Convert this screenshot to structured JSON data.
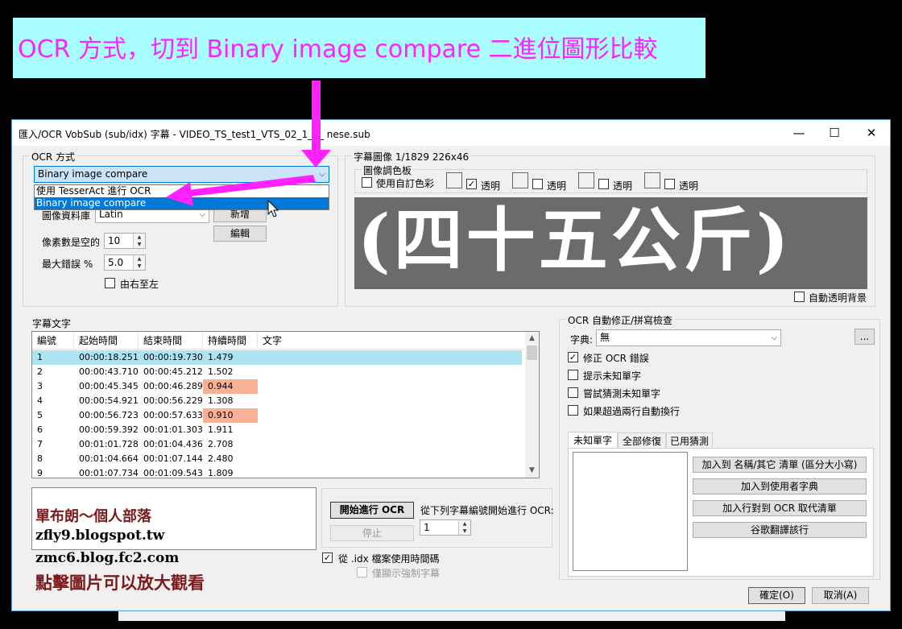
{
  "banner": {
    "text": "OCR 方式，切到 Binary image compare 二進位圖形比較"
  },
  "window": {
    "title": "匯入/OCR VobSub (sub/idx) 字幕 - VIDEO_TS_test1_VTS_02_1_0_  nese.sub",
    "minimize": "—",
    "maximize": "☐",
    "close": "✕"
  },
  "ocr_method": {
    "group_title": "OCR 方式",
    "selected": "Binary image compare",
    "options": [
      "使用 TesserAct 進行 OCR",
      "Binary image compare"
    ],
    "image_db_label": "圖像資料庫",
    "image_db_value": "Latin",
    "new_button": "新增",
    "edit_button": "編輯",
    "pixels_space_label": "像素數是空的",
    "pixels_space_value": "10",
    "max_error_label": "最大錯誤 %",
    "max_error_value": "5.0",
    "rtl_label": "由右至左"
  },
  "subtitle_image": {
    "group_title": "字幕圖像 1/1829   226x46",
    "palette_title": "圖像調色板",
    "custom_colors_label": "使用自訂色彩",
    "transparent_label": "透明",
    "preview_text": "(四十五公斤)",
    "auto_transparent_label": "自動透明背景"
  },
  "subtitle_text": {
    "group_title": "字幕文字",
    "columns": [
      "編號",
      "起始時間",
      "結束時間",
      "持續時間",
      "文字"
    ],
    "rows": [
      {
        "num": "1",
        "start": "00:00:18.251",
        "end": "00:00:19.730",
        "dur": "1.479",
        "text": ""
      },
      {
        "num": "2",
        "start": "00:00:43.710",
        "end": "00:00:45.212",
        "dur": "1.502",
        "text": ""
      },
      {
        "num": "3",
        "start": "00:00:45.345",
        "end": "00:00:46.289",
        "dur": "0.944",
        "text": ""
      },
      {
        "num": "4",
        "start": "00:00:54.921",
        "end": "00:00:56.229",
        "dur": "1.308",
        "text": ""
      },
      {
        "num": "5",
        "start": "00:00:56.723",
        "end": "00:00:57.633",
        "dur": "0.910",
        "text": ""
      },
      {
        "num": "6",
        "start": "00:00:59.392",
        "end": "00:01:01.303",
        "dur": "1.911",
        "text": ""
      },
      {
        "num": "7",
        "start": "00:01:01.728",
        "end": "00:01:04.436",
        "dur": "2.708",
        "text": ""
      },
      {
        "num": "8",
        "start": "00:01:04.664",
        "end": "00:01:07.144",
        "dur": "2.480",
        "text": ""
      },
      {
        "num": "9",
        "start": "00:01:07.734",
        "end": "00:01:09.543",
        "dur": "1.809",
        "text": ""
      }
    ]
  },
  "blog": {
    "line1": "單布朗～個人部落",
    "line2": "zfly9.blogspot.tw",
    "line3": "zmc6.blog.fc2.com",
    "line4": "點擊圖片可以放大觀看"
  },
  "ocr_controls": {
    "start_button": "開始進行 OCR",
    "stop_button": "停止",
    "start_from_label": "從下列字幕編號開始進行 OCR:",
    "start_from_value": "1",
    "use_idx_label": "從 .idx 檔案使用時間碼",
    "forced_only_label": "僅顯示強制字幕"
  },
  "auto_correct": {
    "group_title": "OCR 自動修正/拼寫檢查",
    "dictionary_label": "字典:",
    "dictionary_value": "無",
    "browse_button": "...",
    "fix_ocr_label": "修正 OCR 錯誤",
    "prompt_unknown_label": "提示未知單字",
    "guess_unknown_label": "嘗試猜測未知單字",
    "auto_break_label": "如果超過兩行自動換行",
    "tabs": [
      "未知單字",
      "全部修復",
      "已用猜測"
    ],
    "add_names_button": "加入到 名稱/其它 清單 (區分大小寫)",
    "add_user_dict_button": "加入到使用者字典",
    "add_ocr_replace_button": "加入行對到 OCR 取代清單",
    "google_translate_button": "谷歌翻譯該行"
  },
  "footer": {
    "ok_button": "確定(O)",
    "cancel_button": "取消(A)"
  },
  "colors": {
    "banner_bg": "#a9ffff",
    "banner_text": "#ff22ff",
    "annotation_arrow": "#ff22ff",
    "selected_row": "#aee4f2",
    "warn_cell": "#f9b095",
    "dropdown_selected": "#0078d7"
  }
}
